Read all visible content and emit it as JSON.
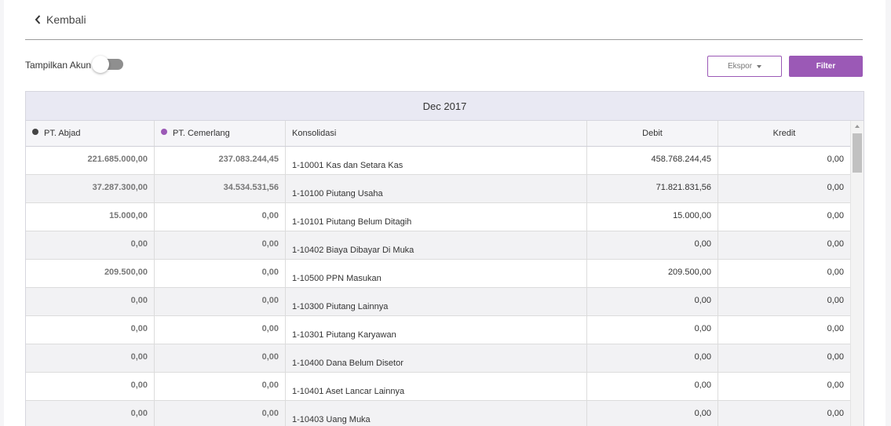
{
  "nav": {
    "back_label": "Kembali",
    "back_icon": "chevron-left-icon"
  },
  "toolbar": {
    "toggle_label": "Tampilkan Akun",
    "toggle_on": false,
    "export_label": "Ekspor",
    "filter_label": "Filter"
  },
  "colors": {
    "accent": "#9b59b6",
    "entity1_dot": "#444444",
    "entity2_dot": "#9b59b6"
  },
  "table": {
    "period": "Dec 2017",
    "headers": {
      "entity1": "PT. Abjad",
      "entity2": "PT. Cemerlang",
      "account": "Konsolidasi",
      "debit": "Debit",
      "credit": "Kredit"
    },
    "rows": [
      {
        "e1": "221.685.000,00",
        "e2": "237.083.244,45",
        "account": "1-10001 Kas dan Setara Kas",
        "debit": "458.768.244,45",
        "credit": "0,00"
      },
      {
        "e1": "37.287.300,00",
        "e2": "34.534.531,56",
        "account": "1-10100 Piutang Usaha",
        "debit": "71.821.831,56",
        "credit": "0,00"
      },
      {
        "e1": "15.000,00",
        "e2": "0,00",
        "account": "1-10101 Piutang Belum Ditagih",
        "debit": "15.000,00",
        "credit": "0,00"
      },
      {
        "e1": "0,00",
        "e2": "0,00",
        "account": "1-10402 Biaya Dibayar Di Muka",
        "debit": "0,00",
        "credit": "0,00"
      },
      {
        "e1": "209.500,00",
        "e2": "0,00",
        "account": "1-10500 PPN Masukan",
        "debit": "209.500,00",
        "credit": "0,00"
      },
      {
        "e1": "0,00",
        "e2": "0,00",
        "account": "1-10300 Piutang Lainnya",
        "debit": "0,00",
        "credit": "0,00"
      },
      {
        "e1": "0,00",
        "e2": "0,00",
        "account": "1-10301 Piutang Karyawan",
        "debit": "0,00",
        "credit": "0,00"
      },
      {
        "e1": "0,00",
        "e2": "0,00",
        "account": "1-10400 Dana Belum Disetor",
        "debit": "0,00",
        "credit": "0,00"
      },
      {
        "e1": "0,00",
        "e2": "0,00",
        "account": "1-10401 Aset Lancar Lainnya",
        "debit": "0,00",
        "credit": "0,00"
      },
      {
        "e1": "0,00",
        "e2": "0,00",
        "account": "1-10403 Uang Muka",
        "debit": "0,00",
        "credit": "0,00"
      }
    ]
  }
}
